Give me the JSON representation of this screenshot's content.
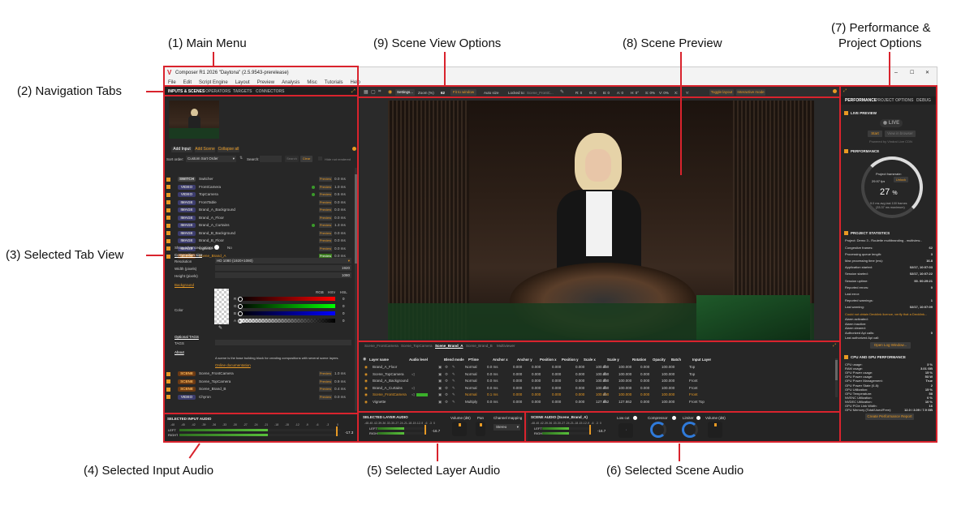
{
  "callouts": {
    "main_menu": "(1) Main Menu",
    "nav_tabs": "(2) Navigation Tabs",
    "selected_tab_view": "(3) Selected Tab View",
    "input_audio": "(4) Selected Input Audio",
    "layer_audio": "(5) Selected Layer Audio",
    "scene_audio": "(6) Selected Scene Audio",
    "perf_line1": "(7) Performance &",
    "perf_line2": "Project Options",
    "scene_preview": "(8) Scene Preview",
    "scene_view_options": "(9) Scene View Options"
  },
  "window": {
    "title": "Composer R1 2026 \"Daytona\" (2.5.9543-prerelease)",
    "min": "–",
    "max": "☐",
    "close": "✕"
  },
  "menu": [
    "File",
    "Edit",
    "Script Engine",
    "Layout",
    "Preview",
    "Analysis",
    "Misc",
    "Tutorials",
    "Help"
  ],
  "nav_tabs": [
    "INPUTS & SCENES",
    "OPERATORS",
    "TARGETS",
    "CONNECTORS"
  ],
  "inputs_panel": {
    "add_input": "Add Input",
    "add_scene": "Add Scene",
    "collapse_all": "Collapse all",
    "sort_label": "Sort order:",
    "sort_value": "Custom Sort Order",
    "search_label": "Search:",
    "search_btn": "Search",
    "clear_btn": "Clear",
    "hide_not_rendered": "Hide not rendered",
    "preview": "Preview",
    "items": [
      {
        "type": "SWITCH",
        "name": "Switcher",
        "ms": "0.0 ms",
        "kind": "switch",
        "on": false
      },
      {
        "type": "VIDEO",
        "name": "FrontCamera",
        "ms": "1.0 ms",
        "kind": "video",
        "on": false
      },
      {
        "type": "VIDEO",
        "name": "TopCamera",
        "ms": "0.5 ms",
        "kind": "video",
        "on": false
      },
      {
        "type": "IMAGE",
        "name": "FrontTable",
        "ms": "0.0 ms",
        "kind": "video",
        "on": false
      },
      {
        "type": "IMAGE",
        "name": "Brand_A_Background",
        "ms": "0.0 ms",
        "kind": "video",
        "on": false
      },
      {
        "type": "IMAGE",
        "name": "Brand_A_Floor",
        "ms": "0.0 ms",
        "kind": "video",
        "on": false
      },
      {
        "type": "IMAGE",
        "name": "Brand_A_Curtains",
        "ms": "1.3 ms",
        "kind": "video",
        "on": false
      },
      {
        "type": "IMAGE",
        "name": "Brand_B_Background",
        "ms": "0.0 ms",
        "kind": "video",
        "on": false
      },
      {
        "type": "IMAGE",
        "name": "Brand_B_Floor",
        "ms": "0.0 ms",
        "kind": "video",
        "on": false
      },
      {
        "type": "IMAGE",
        "name": "Vignette",
        "ms": "0.0 ms",
        "kind": "video",
        "on": false
      },
      {
        "type": "SCENE",
        "name": "Scene_Brand_A",
        "ms": "0.0 ms",
        "kind": "scene",
        "on": true
      }
    ],
    "show_advanced": "Show advanced options",
    "no": "No",
    "comp_size": "Composition size",
    "resolution_label": "Resolution",
    "resolution_value": "HD 1080 (1920×1080)",
    "width_label": "Width (pixels)",
    "width_value": "1920",
    "height_label": "Height (pixels)",
    "height_value": "1080",
    "background": "Background",
    "rgb": "RGB",
    "hsv": "HSV",
    "hsl": "HSL",
    "color_label": "Color",
    "channels": [
      "R",
      "G",
      "B",
      "A"
    ],
    "channel_values": [
      "0",
      "0",
      "0",
      "0"
    ],
    "optional_tags": "Optional TAGS",
    "tags_label": "TAGS",
    "about": "About",
    "about_text": "A scene is the base building block for creating compositions with several scene layers.",
    "online_doc": "Online documentation",
    "items_after": [
      {
        "type": "SCENE",
        "name": "Scene_FrontCamera",
        "ms": "1.0 ms"
      },
      {
        "type": "SCENE",
        "name": "Scene_TopCamera",
        "ms": "0.9 ms"
      },
      {
        "type": "SCENE",
        "name": "Scene_Brand_B",
        "ms": "0.4 ms"
      },
      {
        "type": "VIDEO",
        "name": "Chyron",
        "ms": "0.0 ms"
      }
    ]
  },
  "input_audio": {
    "title": "SELECTED INPUT AUDIO",
    "left": "LEFT",
    "right": "RIGHT",
    "value": "-17.3",
    "scale": [
      "-48",
      "-45",
      "-42",
      "-39",
      "-36",
      "-33",
      "-30",
      "-27",
      "-24",
      "-21",
      "-18",
      "-15",
      "-12",
      "-9",
      "-6",
      "-3",
      "0"
    ]
  },
  "view_options": {
    "settings": "Settings...",
    "zoom_label": "Zoom (%)",
    "zoom_value": "62",
    "fit": "Fit to window",
    "auto_size": "Auto size",
    "locked_to": "Locked to:",
    "locked_value": "Scene_FrontC...",
    "r": "R: 0",
    "g": "G: 0",
    "b": "B: 0",
    "a": "A: 0",
    "h": "H: 0°",
    "s": "S: 0%",
    "v": "V: 0%",
    "x": "X:",
    "y": "Y:",
    "toggle_layout": "Toggle layout",
    "interactive": "Interactive mode"
  },
  "scene_tabs": [
    "Scene_FrontCamera",
    "Scene_TopCamera",
    "Scene_Brand_A",
    "Scene_Brand_B",
    "Multiviewer"
  ],
  "layers": {
    "headers": [
      "Layer name",
      "Audio level",
      "Blend mode",
      "PTime",
      "Anchor x",
      "Anchor y",
      "Position x",
      "Position y",
      "Scale x",
      "Scale y",
      "Rotation",
      "Opacity",
      "Batch",
      "Input Layer"
    ],
    "rows": [
      {
        "name": "Brand_A_Floor",
        "blend": "Normal",
        "pt": "0.0 ms",
        "ax": "0.000",
        "ay": "0.000",
        "px": "0.000",
        "py": "0.000",
        "sx": "100.000",
        "sy": "100.000",
        "rot": "0.000",
        "op": "100.000",
        "batch": "Top"
      },
      {
        "name": "Scene_TopCamera",
        "blend": "Normal",
        "pt": "0.0 ms",
        "ax": "0.000",
        "ay": "0.000",
        "px": "0.000",
        "py": "0.000",
        "sx": "100.000",
        "sy": "100.000",
        "rot": "0.000",
        "op": "100.000",
        "batch": "Top"
      },
      {
        "name": "Brand_A_Background",
        "blend": "Normal",
        "pt": "0.0 ms",
        "ax": "0.000",
        "ay": "0.000",
        "px": "0.000",
        "py": "0.000",
        "sx": "100.000",
        "sy": "100.000",
        "rot": "0.000",
        "op": "100.000",
        "batch": "Front"
      },
      {
        "name": "Brand_A_Curtains",
        "blend": "Normal",
        "pt": "0.0 ms",
        "ax": "0.000",
        "ay": "0.000",
        "px": "0.000",
        "py": "0.000",
        "sx": "100.000",
        "sy": "100.000",
        "rot": "0.000",
        "op": "100.000",
        "batch": "Front"
      },
      {
        "name": "Scene_FrontCamera",
        "blend": "Normal",
        "pt": "0.1 ms",
        "ax": "0.000",
        "ay": "0.000",
        "px": "0.000",
        "py": "0.000",
        "sx": "100.000",
        "sy": "100.000",
        "rot": "0.000",
        "op": "100.000",
        "batch": "Front"
      },
      {
        "name": "Vignette",
        "blend": "Multiply",
        "pt": "0.0 ms",
        "ax": "0.000",
        "ay": "0.000",
        "px": "0.000",
        "py": "0.000",
        "sx": "127.862",
        "sy": "127.862",
        "rot": "0.000",
        "op": "100.000",
        "batch": "Front Top"
      }
    ]
  },
  "layer_audio": {
    "title": "SELECTED LAYER AUDIO",
    "volume": "Volume (dB)",
    "pan": "Pan",
    "channel_mapping": "Channel mapping",
    "mapping_value": "Stereo",
    "left": "LEFT",
    "right": "RIGHT",
    "value": "-16.7",
    "scale": [
      "-48",
      "-45",
      "-42",
      "-39",
      "-36",
      "-33",
      "-30",
      "-27",
      "-24",
      "-21",
      "-18",
      "-15",
      "-12",
      "-9",
      "-6",
      "-3",
      "0"
    ]
  },
  "scene_audio": {
    "title": "SCENE AUDIO (Scene_Brand_A)",
    "left": "LEFT",
    "right": "RIGHT",
    "value": "-16.7",
    "low_cut": "Low cut",
    "compressor": "Compressor",
    "limiter": "Limiter",
    "volume": "Volume (dB)",
    "scale": [
      "-48",
      "-45",
      "-42",
      "-39",
      "-36",
      "-33",
      "-30",
      "-27",
      "-24",
      "-21",
      "-18",
      "-15",
      "-12",
      "-9",
      "-6",
      "-3",
      "0"
    ]
  },
  "perf_tabs": [
    "PERFORMANCE",
    "PROJECT OPTIONS",
    "DEBUG"
  ],
  "live_preview": {
    "title": "LIVE PREVIEW",
    "live": "LIVE",
    "start": "Start",
    "view": "View in browser",
    "powered": "Powered by Vindral Live CDN"
  },
  "performance": {
    "title": "PERFORMANCE",
    "framerate_label": "Project framerate:",
    "fps": "29.97 fps",
    "unlock": "Unlock",
    "percent": "27",
    "unit": "%",
    "line1": "9.0 ms avg last 100 frames",
    "line2": "(33.37 ms maximum)"
  },
  "project_stats": {
    "title": "PROJECT STATISTICS",
    "project": "Project: Demo 3 - Roulette multibranding - multiview...",
    "rows": [
      [
        "Congestive frames:",
        "62"
      ],
      [
        "Processing queue length:",
        "3"
      ],
      [
        "Max processing time (ms):",
        "16.8"
      ],
      [
        "Application started:",
        "02/17, 10:07:03"
      ],
      [
        "Session started:",
        "02/17, 10:07:22"
      ],
      [
        "Session uptime:",
        "00. 00:29:21"
      ],
      [
        "Reported errors:",
        "0"
      ],
      [
        "Last error:",
        ""
      ],
      [
        "Reported warnings:",
        "1"
      ],
      [
        "Last warning:",
        "02/17, 10:07:09"
      ]
    ],
    "warning": "Could not obtain Decklink licence, verify that a Decklink...",
    "rows2": [
      [
        "Alarm activated:",
        ""
      ],
      [
        "Alarm inactive:",
        ""
      ],
      [
        "Alarm cleared:",
        ""
      ],
      [
        "Authorized Api calls:",
        "0"
      ],
      [
        "Last authorized Api call:",
        ""
      ]
    ],
    "open_log": "Open Log Window..."
  },
  "cpu_gpu": {
    "title": "CPU AND GPU PERFORMANCE",
    "rows": [
      [
        "CPU usage:",
        "3 %"
      ],
      [
        "RAM usage:",
        "3.01 GB"
      ],
      [
        "GPU Power usage:",
        "15 %"
      ],
      [
        "GPU Power usage:",
        "53 W"
      ],
      [
        "GPU Power Management:",
        "True"
      ],
      [
        "GPU Power State (0-8):",
        "2"
      ],
      [
        "GPU Utilization:",
        "15 %"
      ],
      [
        "GPU Temperature:",
        "58"
      ],
      [
        "NVENC Utilization:",
        "0 %"
      ],
      [
        "NVDEC Utilization:",
        "10 %"
      ],
      [
        "GPU PCIe Link Width:",
        "16"
      ],
      [
        "GPU Memory (Total/Used/Free):",
        "12.0 / 3.09 / 7.9 GB"
      ]
    ],
    "report": "Create Performance Report"
  },
  "colors": {
    "accent": "#e89a24",
    "red": "#d9232d",
    "scene_bg": "#1c1410"
  }
}
